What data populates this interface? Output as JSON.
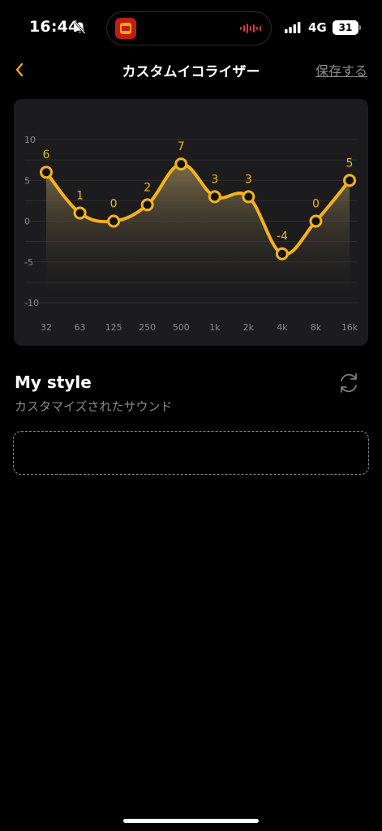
{
  "status_bar": {
    "time": "16:44",
    "network": "4G",
    "battery_percent": "31",
    "battery_level": 0.31,
    "icons": [
      "bell-slash-icon",
      "signal-icon"
    ]
  },
  "header": {
    "title": "カスタムイコライザー",
    "save_label": "保存する",
    "back_icon": "chevron-left-icon"
  },
  "colors": {
    "accent": "#F6B21B",
    "card_bg": "#1C1C1E",
    "muted": "#8A8A8A"
  },
  "chart_data": {
    "type": "line",
    "x": [
      "32",
      "63",
      "125",
      "250",
      "500",
      "1k",
      "2k",
      "4k",
      "8k",
      "16k"
    ],
    "values": [
      6,
      1,
      0,
      2,
      7,
      3,
      3,
      -4,
      0,
      5
    ],
    "point_labels": [
      "6",
      "1",
      "0",
      "2",
      "7",
      "3",
      "3",
      "-4",
      "0",
      "5"
    ],
    "y_ticks": [
      "10",
      "5",
      "0",
      "-5",
      "-10"
    ],
    "ylim": [
      -10,
      10
    ],
    "grid": true,
    "fill": "gradient-area",
    "series_color": "#F6B21B"
  },
  "my_style": {
    "title": "My style",
    "subtitle": "カスタマイズされたサウンド",
    "reset_icon": "sync-icon"
  }
}
